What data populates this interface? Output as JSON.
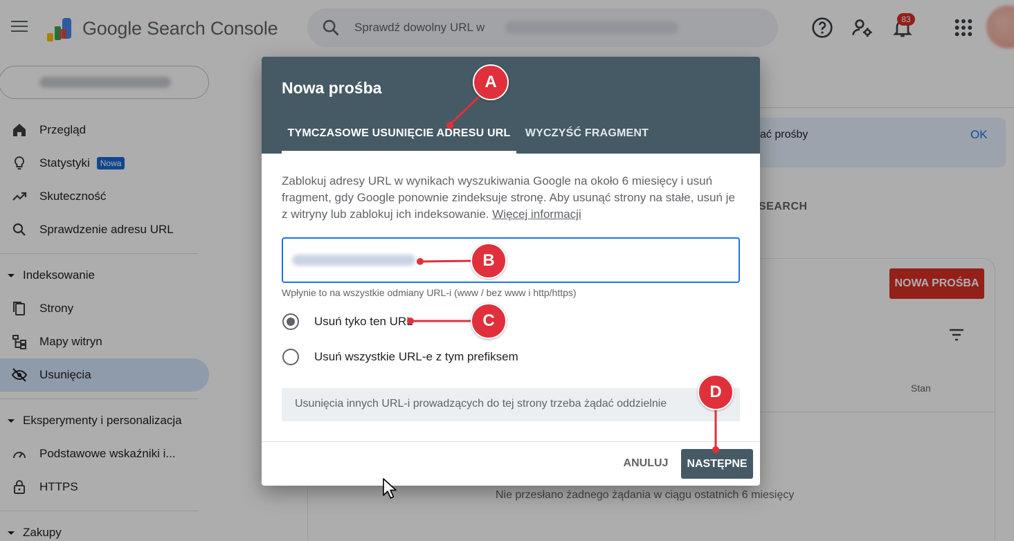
{
  "app": {
    "title": "Google Search Console",
    "search_placeholder": "Sprawdź dowolny URL w",
    "notification_count": "83"
  },
  "sidebar": {
    "items": [
      {
        "label": "Przegląd",
        "icon": "home-icon"
      },
      {
        "label": "Statystyki",
        "icon": "lightbulb-icon",
        "badge": "Nowa"
      },
      {
        "label": "Skuteczność",
        "icon": "trending-up-icon"
      },
      {
        "label": "Sprawdzenie adresu URL",
        "icon": "search-icon"
      }
    ],
    "section_indexing": "Indeksowanie",
    "indexing_items": [
      {
        "label": "Strony",
        "icon": "pages-icon"
      },
      {
        "label": "Mapy witryn",
        "icon": "sitemap-icon"
      },
      {
        "label": "Usunięcia",
        "icon": "eye-off-icon",
        "active": true
      }
    ],
    "section_experience": "Eksperymenty i personalizacja",
    "experience_items": [
      {
        "label": "Podstawowe wskaźniki i...",
        "icon": "speed-icon"
      },
      {
        "label": "HTTPS",
        "icon": "lock-icon"
      }
    ],
    "section_shopping": "Zakupy"
  },
  "background": {
    "banner_text": "ać prośby",
    "banner_ok": "OK",
    "tab_fragment": "SEARCH",
    "new_request_button": "NOWA PROŚBA",
    "column_status": "Stan",
    "empty_message": "Nie przesłano żadnego żądania w ciągu ostatnich 6 miesięcy"
  },
  "dialog": {
    "title": "Nowa prośba",
    "tabs": [
      {
        "label": "TYMCZASOWE USUNIĘCIE ADRESU URL",
        "active": true
      },
      {
        "label": "WYCZYŚĆ FRAGMENT",
        "active": false
      }
    ],
    "description": "Zablokuj adresy URL w wynikach wyszukiwania Google na około 6 miesięcy i usuń fragment, gdy Google ponownie zindeksuje stronę. Aby usunąć strony na stałe, usuń je z witryny lub zablokuj ich indeksowanie. ",
    "learn_more": "Więcej informacji",
    "url_hint": "Wpłynie to na wszystkie odmiany URL-i (www / bez www i http/https)",
    "radio_options": [
      {
        "label": "Usuń tyko ten URL",
        "checked": true
      },
      {
        "label": "Usuń wszystkie URL-e z tym prefiksem",
        "checked": false
      }
    ],
    "note": "Usunięcia innych URL-i prowadzących do tej strony trzeba żądać oddzielnie",
    "cancel_label": "ANULUJ",
    "next_label": "NASTĘPNE"
  },
  "annotations": {
    "markers": [
      "A",
      "B",
      "C",
      "D"
    ],
    "color": "#e0303c"
  },
  "colors": {
    "dialog_header": "#455a64",
    "accent_blue": "#1a73e8",
    "active_nav": "#d3e3fd",
    "brand_red": "#d93025"
  }
}
